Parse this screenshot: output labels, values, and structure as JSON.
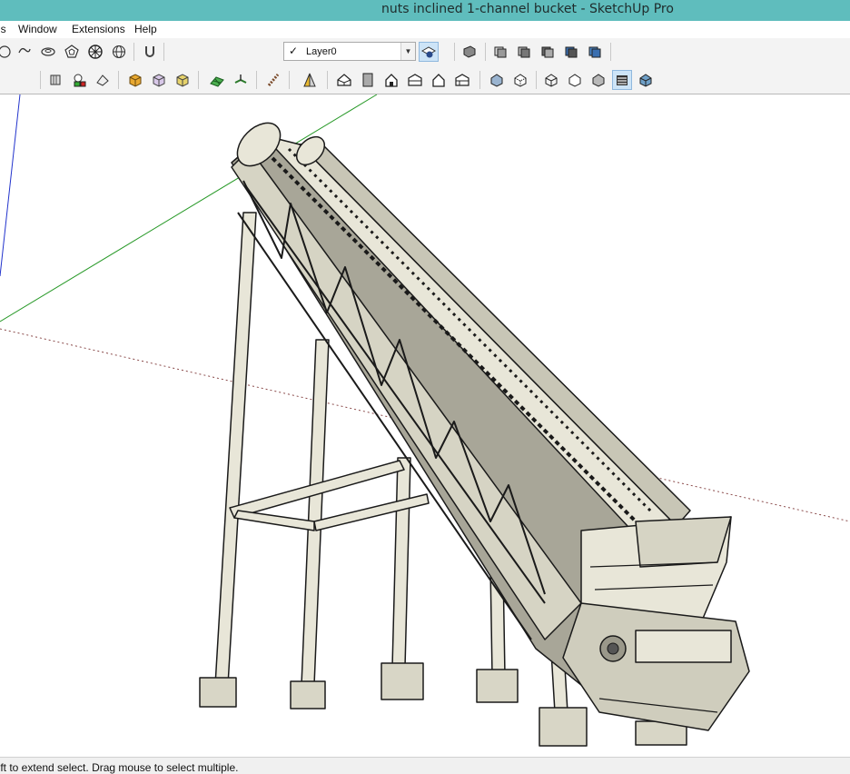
{
  "window": {
    "title": "nuts inclined 1-channel bucket - SketchUp Pro"
  },
  "menu": {
    "items": [
      "ls",
      "Window",
      "Extensions",
      "Help"
    ]
  },
  "layers": {
    "current": "Layer0"
  },
  "status": {
    "hint": "hift to extend select. Drag mouse to select multiple."
  },
  "colors": {
    "titlebar": "#5fbdbd",
    "toolbar": "#f3f3f3",
    "model_face": "#e8e6d8",
    "model_shadow": "#a8a698",
    "model_edge": "#1a1a1a",
    "axis_green": "#2a9a2a",
    "axis_blue": "#2233cc",
    "axis_red_dotted": "#8a4a4a"
  }
}
